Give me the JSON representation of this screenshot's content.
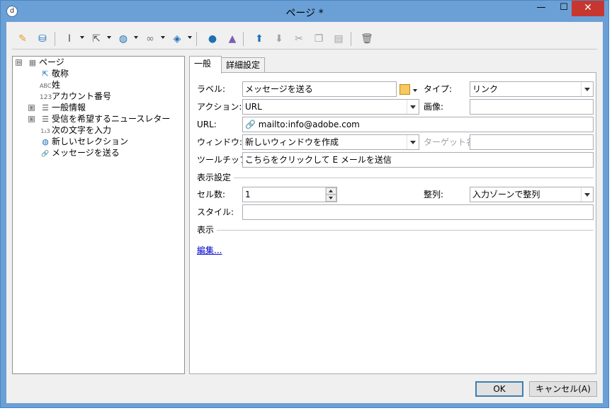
{
  "window": {
    "title": "ページ *",
    "minimize_glyph": "—",
    "maximize_glyph": "☐",
    "close_glyph": "✕",
    "app_icon_glyph": "d"
  },
  "toolbar": {
    "icons": [
      "magic-wand-icon",
      "database-icon",
      "text-cursor-icon",
      "cursor-settings-icon",
      "globe-icon",
      "link-icon",
      "stack-icon",
      "person-icon",
      "shapes-icon",
      "arrow-up-icon",
      "arrow-down-icon",
      "cut-icon",
      "copy-icon",
      "paste-icon",
      "trash-icon"
    ]
  },
  "tree": {
    "root": {
      "label": "ページ",
      "icon": "page-icon",
      "expander": "⊟"
    },
    "items": [
      {
        "label": "敬称",
        "icon": "cursor-icon",
        "glyph": "⇱"
      },
      {
        "label": "姓",
        "icon": "text-field-icon",
        "glyph": "ABC"
      },
      {
        "label": "アカウント番号",
        "icon": "number-field-icon",
        "glyph": "123"
      },
      {
        "label": "一般情報",
        "icon": "list-icon",
        "glyph": "☰",
        "expander": "⊞"
      },
      {
        "label": "受信を希望するニュースレター",
        "icon": "list-icon",
        "glyph": "☰",
        "expander": "⊞"
      },
      {
        "label": "次の文字を入力",
        "icon": "captcha-icon",
        "glyph": "1₂3"
      },
      {
        "label": "新しいセレクション",
        "icon": "globe-icon",
        "glyph": "◍"
      },
      {
        "label": "メッセージを送る",
        "icon": "link-icon",
        "glyph": "🔗"
      }
    ]
  },
  "tabs": [
    {
      "label": "一般"
    },
    {
      "label": "詳細設定"
    }
  ],
  "form": {
    "label_label": "ラベル:",
    "label_value": "メッセージを送る",
    "type_label": "タイプ:",
    "type_value": "リンク",
    "action_label": "アクション:",
    "action_value": "URL",
    "image_label": "画像:",
    "image_value": "",
    "url_label": "URL:",
    "url_value": "mailto:info@adobe.com",
    "window_label": "ウィンドウ:",
    "window_value": "新しいウィンドウを作成",
    "target_label": "ターゲット名:",
    "target_value": "",
    "tooltip_label": "ツールチップ:",
    "tooltip_value": "こちらをクリックして E メールを送信",
    "display_section": "表示設定",
    "cells_label": "セル数:",
    "cells_value": "1",
    "align_label": "整列:",
    "align_value": "入力ゾーンで整列",
    "style_label": "スタイル:",
    "style_value": "",
    "view_section": "表示",
    "edit_link": "編集..."
  },
  "buttons": {
    "ok": "OK",
    "cancel": "キャンセル(A)"
  }
}
